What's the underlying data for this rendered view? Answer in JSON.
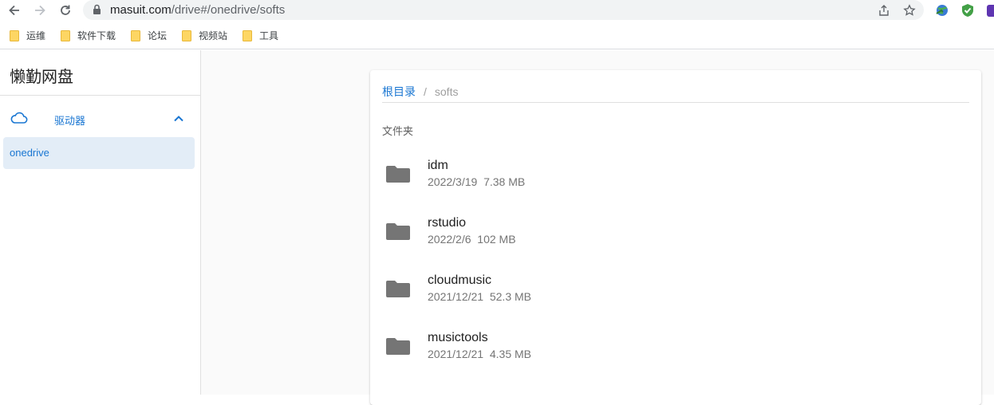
{
  "browser": {
    "url_host": "masuit.com",
    "url_path": "/drive#/onedrive/softs",
    "bookmarks": [
      {
        "label": "运维"
      },
      {
        "label": "软件下载"
      },
      {
        "label": "论坛"
      },
      {
        "label": "视频站"
      },
      {
        "label": "工具"
      }
    ]
  },
  "app": {
    "title": "懒勤网盘",
    "drive_group_label": "驱动器",
    "drive_items": [
      {
        "label": "onedrive"
      }
    ]
  },
  "breadcrumb": {
    "root": "根目录",
    "separator": "/",
    "current": "softs"
  },
  "section_label": "文件夹",
  "folders": [
    {
      "name": "idm",
      "date": "2022/3/19",
      "size": "7.38 MB"
    },
    {
      "name": "rstudio",
      "date": "2022/2/6",
      "size": "102 MB"
    },
    {
      "name": "cloudmusic",
      "date": "2021/12/21",
      "size": "52.3 MB"
    },
    {
      "name": "musictools",
      "date": "2021/12/21",
      "size": "4.35 MB"
    }
  ],
  "colors": {
    "accent": "#1976d2",
    "folder_icon": "#757575",
    "selected_bg": "#e3edf7"
  }
}
